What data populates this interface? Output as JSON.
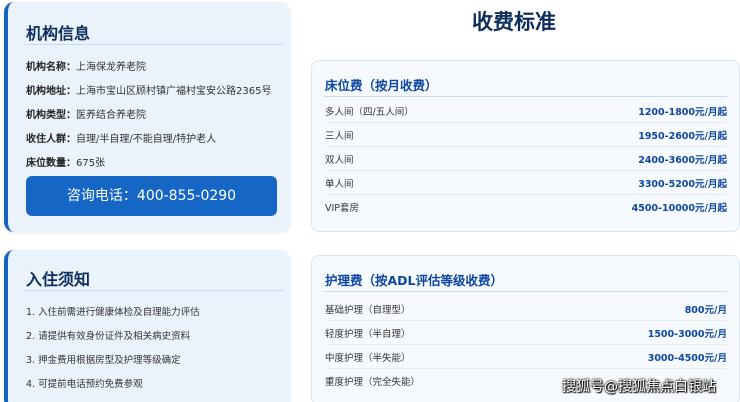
{
  "org": {
    "title": "机构信息",
    "rows": [
      {
        "k": "机构名称：",
        "v": "上海保龙养老院"
      },
      {
        "k": "机构地址：",
        "v": "上海市宝山区顾村镇广福村宝安公路2365号"
      },
      {
        "k": "机构类型：",
        "v": "医养结合养老院"
      },
      {
        "k": "收住人群：",
        "v": "自理/半自理/不能自理/特护老人"
      },
      {
        "k": "床位数量：",
        "v": "675张"
      }
    ],
    "consult_label": "咨询电话：400-855-0290"
  },
  "notice": {
    "title": "入住须知",
    "items": [
      "1. 入住前需进行健康体检及自理能力评估",
      "2. 请提供有效身份证件及相关病史资料",
      "3. 押金费用根据房型及护理等级确定",
      "4. 可提前电话预约免费参观"
    ]
  },
  "fees": {
    "title": "收费标准",
    "bed": {
      "title": "床位费（按月收费）",
      "rows": [
        {
          "name": "多人间（四/五人间）",
          "price": "1200-1800元/月起"
        },
        {
          "name": "三人间",
          "price": "1950-2600元/月起"
        },
        {
          "name": "双人间",
          "price": "2400-3600元/月起"
        },
        {
          "name": "单人间",
          "price": "3300-5200元/月起"
        },
        {
          "name": "VIP套房",
          "price": "4500-10000元/月起"
        }
      ]
    },
    "care": {
      "title": "护理费（按ADL评估等级收费）",
      "rows": [
        {
          "name": "基础护理（自理型）",
          "price": "800元/月"
        },
        {
          "name": "轻度护理（半自理）",
          "price": "1500-3000元/月"
        },
        {
          "name": "中度护理（半失能）",
          "price": "3000-4500元/月"
        },
        {
          "name": "重度护理（完全失能）",
          "price": ""
        }
      ]
    }
  },
  "watermark": "搜狐号@搜狐焦点白银站"
}
